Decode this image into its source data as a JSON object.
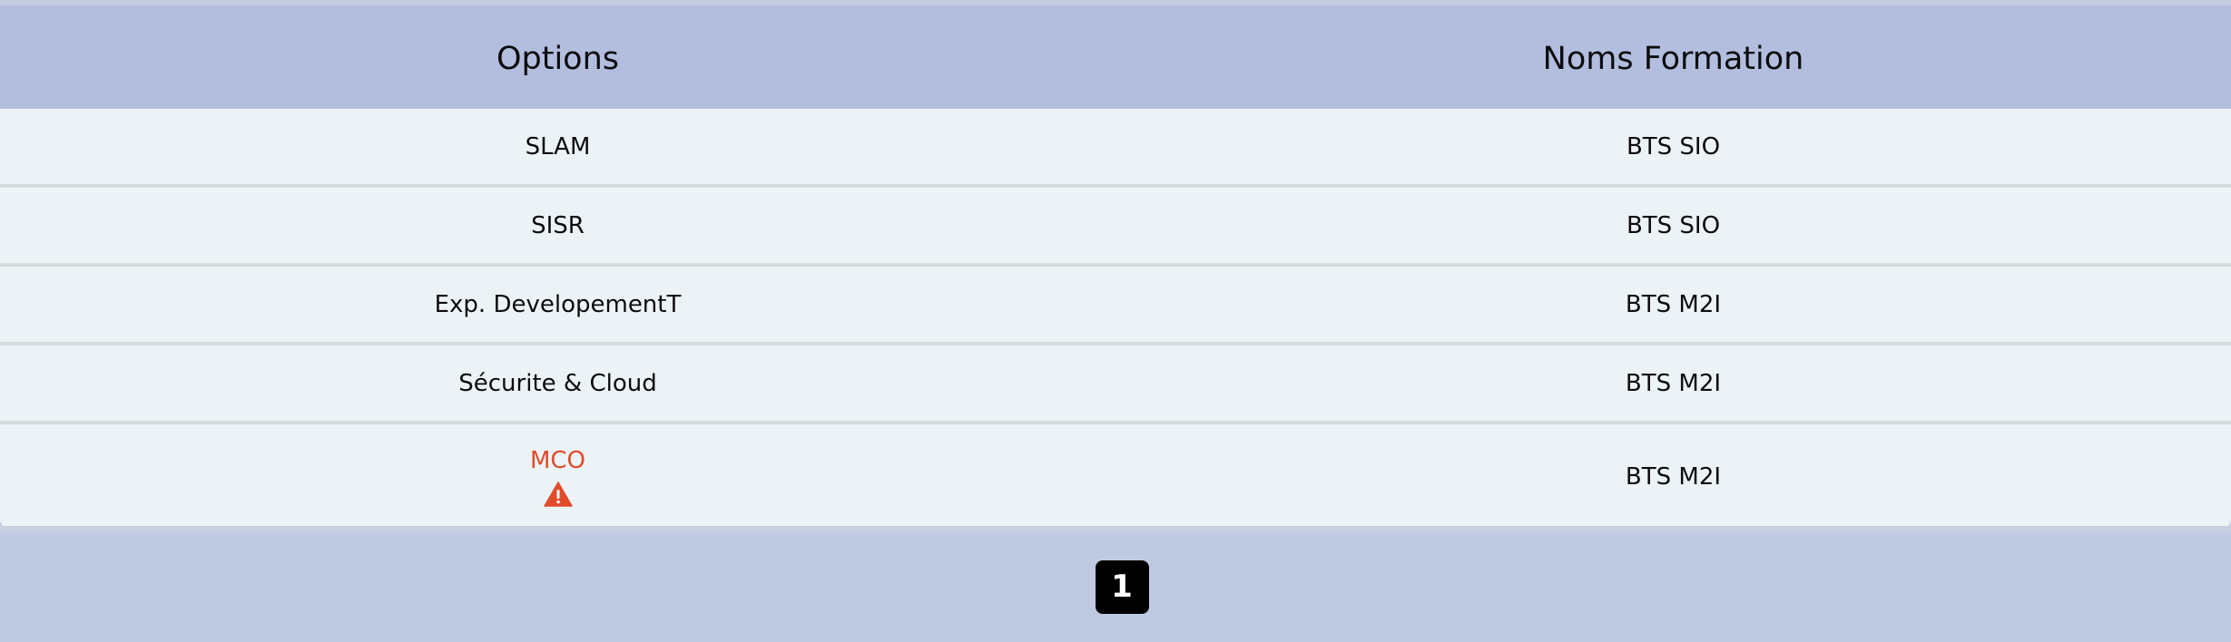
{
  "table": {
    "headers": [
      "Options",
      "Noms Formation"
    ],
    "rows": [
      {
        "option": "SLAM",
        "formation": "BTS SIO"
      },
      {
        "option": "SISR",
        "formation": "BTS SIO"
      },
      {
        "option": "Exp. DevelopementT",
        "formation": "BTS M2I"
      },
      {
        "option": "Sécurite & Cloud",
        "formation": "BTS M2I"
      },
      {
        "option": "MCO",
        "formation": "BTS M2I",
        "warning_icon": "warning-triangle-icon"
      }
    ]
  },
  "pagination": {
    "current_page": "1"
  },
  "colors": {
    "header_bg": "#b3bedf",
    "row_bg": "#ecf3f7",
    "page_bg": "#bfcae2",
    "alert": "#e14b2a",
    "pager_bg": "#000000"
  }
}
